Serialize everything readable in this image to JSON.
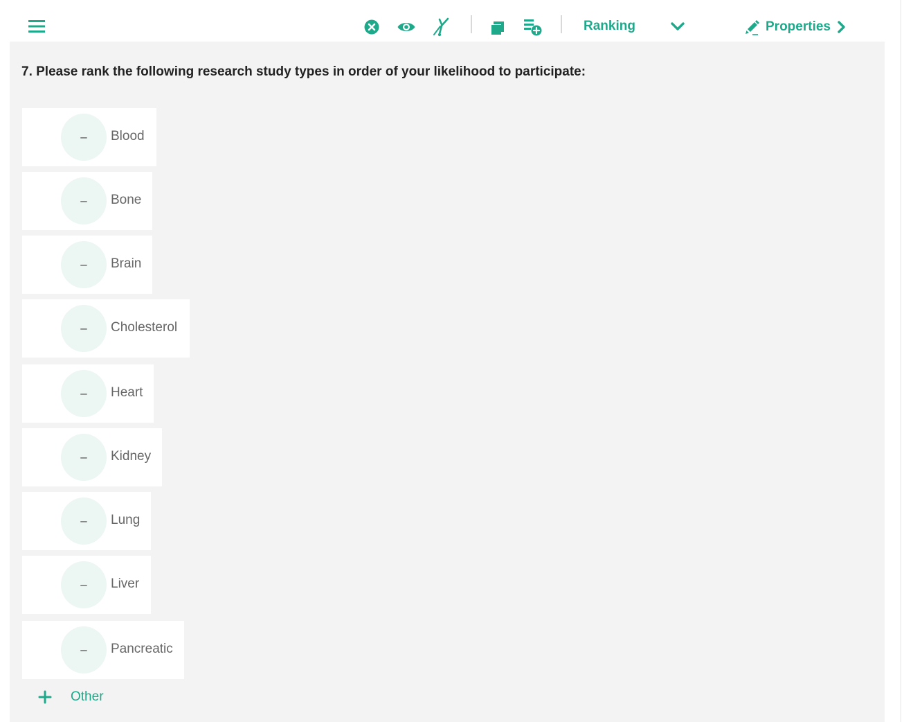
{
  "toolbar": {
    "question_type": "Ranking",
    "properties_label": "Properties",
    "icons": [
      "menu-icon",
      "clear-circle-icon",
      "eye-icon",
      "skip-logic-icon",
      "copy-icon",
      "add-question-icon",
      "chevron-down-icon",
      "pencil-icon",
      "chevron-right-icon"
    ],
    "accent_color": "#1fa98b"
  },
  "question": {
    "text": "7. Please rank the following research study types in order of your likelihood to participate:",
    "choices": [
      {
        "rank": "–",
        "label": "Blood"
      },
      {
        "rank": "–",
        "label": "Bone"
      },
      {
        "rank": "–",
        "label": "Brain"
      },
      {
        "rank": "–",
        "label": "Cholesterol"
      },
      {
        "rank": "–",
        "label": "Heart"
      },
      {
        "rank": "–",
        "label": "Kidney"
      },
      {
        "rank": "–",
        "label": "Lung"
      },
      {
        "rank": "–",
        "label": "Liver"
      },
      {
        "rank": "–",
        "label": "Pancreatic"
      }
    ],
    "add_other_label": "Other"
  }
}
